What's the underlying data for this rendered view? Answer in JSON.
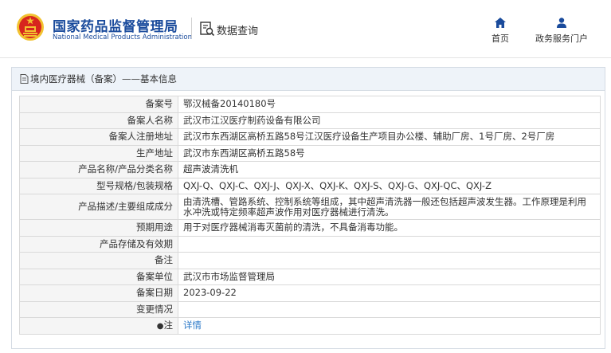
{
  "header": {
    "org_name_cn": "国家药品监督管理局",
    "org_name_en": "National Medical Products Administration",
    "query_label": "数据查询",
    "nav": [
      {
        "label": "首页",
        "icon": "home-icon"
      },
      {
        "label": "政务服务门户",
        "icon": "user-icon"
      }
    ]
  },
  "panel": {
    "title": "境内医疗器械（备案）——基本信息"
  },
  "record": {
    "rows": [
      {
        "label": "备案号",
        "value": "鄂汉械备20140180号"
      },
      {
        "label": "备案人名称",
        "value": "武汉市江汉医疗制药设备有限公司"
      },
      {
        "label": "备案人注册地址",
        "value": "武汉市东西湖区高桥五路58号江汉医疗设备生产项目办公楼、辅助厂房、1号厂房、2号厂房"
      },
      {
        "label": "生产地址",
        "value": "武汉市东西湖区高桥五路58号"
      },
      {
        "label": "产品名称/产品分类名称",
        "value": "超声波清洗机"
      },
      {
        "label": "型号规格/包装规格",
        "value": "QXJ-Q、QXJ-C、QXJ-J、QXJ-X、QXJ-K、QXJ-S、QXJ-G、QXJ-QC、QXJ-Z"
      },
      {
        "label": "产品描述/主要组成成分",
        "value": "由清洗槽、管路系统、控制系统等组成，其中超声清洗器一般还包括超声波发生器。工作原理是利用水冲洗或特定频率超声波作用对医疗器械进行清洗。"
      },
      {
        "label": "预期用途",
        "value": "用于对医疗器械消毒灭菌前的清洗，不具备消毒功能。"
      },
      {
        "label": "产品存储及有效期",
        "value": ""
      },
      {
        "label": "备注",
        "value": ""
      },
      {
        "label": "备案单位",
        "value": "武汉市市场监督管理局"
      },
      {
        "label": "备案日期",
        "value": "2023-09-22"
      },
      {
        "label": "变更情况",
        "value": ""
      }
    ],
    "note_row": {
      "label": "注",
      "link": "详情"
    }
  },
  "colors": {
    "brand_blue": "#1a4b9c",
    "panel_header_bg": "#eef3f9",
    "label_bg": "#f5f5f5",
    "link": "#2a78c8",
    "emblem_red": "#d7261e",
    "emblem_gold": "#f2c230"
  }
}
